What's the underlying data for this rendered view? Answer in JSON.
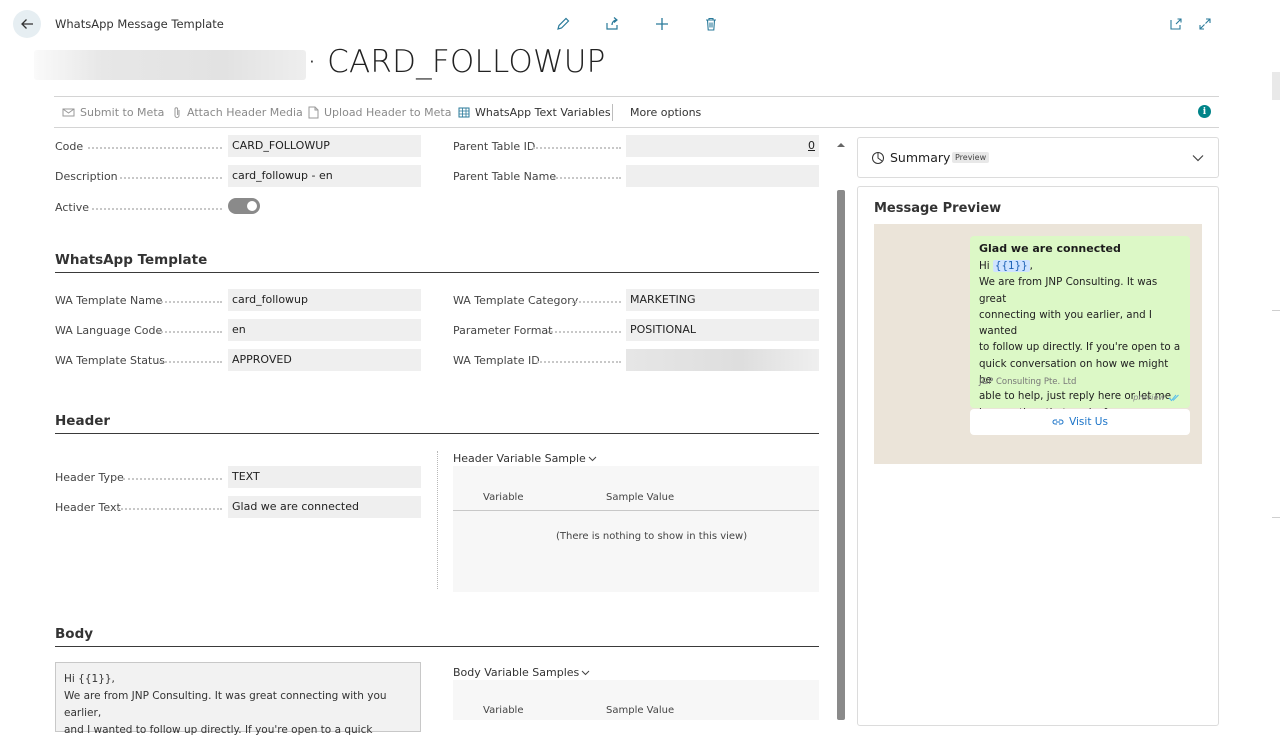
{
  "header": {
    "page_name": "WhatsApp Message Template",
    "record_title": "· CARD_FOLLOWUP"
  },
  "actions": [
    {
      "label": "Submit to Meta",
      "icon": "send-icon",
      "enabled": false
    },
    {
      "label": "Attach Header Media",
      "icon": "paperclip-icon",
      "enabled": false
    },
    {
      "label": "Upload Header to Meta",
      "icon": "document-icon",
      "enabled": false
    },
    {
      "label": "WhatsApp Text Variables",
      "icon": "table-icon",
      "enabled": true
    },
    {
      "label": "More options",
      "icon": "",
      "enabled": true
    }
  ],
  "general": {
    "code_label": "Code",
    "code_value": "CARD_FOLLOWUP",
    "description_label": "Description",
    "description_value": "card_followup - en",
    "active_label": "Active",
    "active_value": true,
    "parent_table_id_label": "Parent Table ID",
    "parent_table_id_value": "0",
    "parent_table_name_label": "Parent Table Name",
    "parent_table_name_value": ""
  },
  "wa_template": {
    "title": "WhatsApp Template",
    "name_label": "WA Template Name",
    "name_value": "card_followup",
    "language_label": "WA Language Code",
    "language_value": "en",
    "status_label": "WA Template Status",
    "status_value": "APPROVED",
    "category_label": "WA Template Category",
    "category_value": "MARKETING",
    "param_format_label": "Parameter Format",
    "param_format_value": "POSITIONAL",
    "template_id_label": "WA Template ID"
  },
  "header_section": {
    "title": "Header",
    "type_label": "Header Type",
    "type_value": "TEXT",
    "text_label": "Header Text",
    "text_value": "Glad we are connected",
    "grid_caption": "Header Variable Sample",
    "col_variable": "Variable",
    "col_sample": "Sample Value",
    "empty_text": "(There is nothing to show in this view)"
  },
  "body_section": {
    "title": "Body",
    "text_lines": [
      "Hi {{1}},",
      "We are from JNP Consulting. It was great connecting with you earlier,",
      "and I wanted to follow up directly. If you're open to a quick"
    ],
    "grid_caption": "Body Variable Samples",
    "col_variable": "Variable",
    "col_sample": "Sample Value"
  },
  "summary": {
    "title": "Summary",
    "badge": "Preview"
  },
  "message_preview": {
    "title": "Message Preview",
    "bubble_title": "Glad we are connected",
    "greeting_prefix": "Hi",
    "greeting_var": "{{1}}",
    "greeting_suffix": ",",
    "body_lines": [
      "We are from JNP Consulting. It was great",
      "connecting with you earlier, and I wanted",
      "to follow up directly. If you're open to a",
      "quick conversation on how we might be",
      "able to help, just reply here or let me",
      "know a time that works for you"
    ],
    "footer": "J&P Consulting Pte. Ltd",
    "meta": "preview",
    "cta_label": "Visit Us"
  },
  "colors": {
    "bubble": "#dcf8c6",
    "chat_bg": "#ebe4d9",
    "accent": "#008489",
    "link": "#1a73c8"
  }
}
